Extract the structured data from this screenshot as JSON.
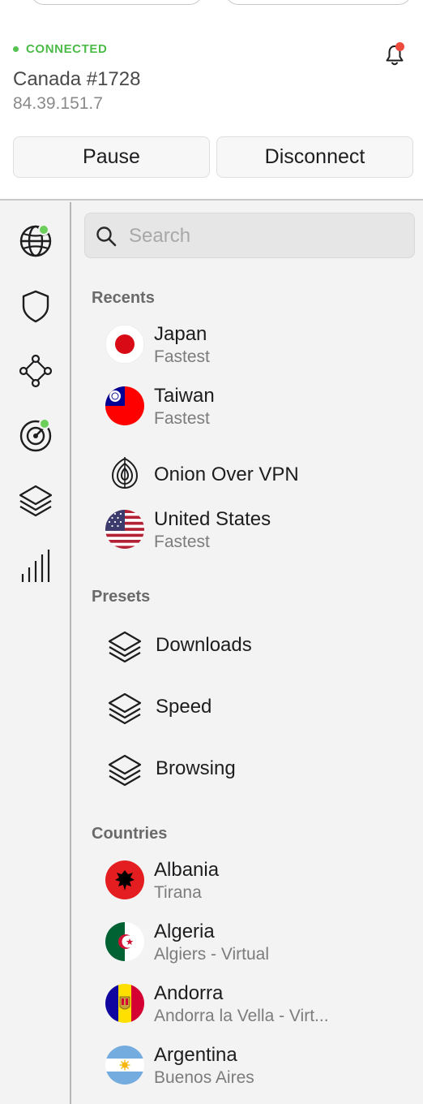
{
  "status": {
    "label": "CONNECTED",
    "color": "#4cbc48"
  },
  "server": {
    "name": "Canada #1728",
    "ip": "84.39.151.7"
  },
  "actions": {
    "pause": "Pause",
    "disconnect": "Disconnect"
  },
  "notifications": {
    "icon": "bell-icon",
    "has_badge": true
  },
  "rail": [
    {
      "icon": "globe-icon",
      "badge": true
    },
    {
      "icon": "shield-icon",
      "badge": false
    },
    {
      "icon": "meshnet-icon",
      "badge": false
    },
    {
      "icon": "threat-target-icon",
      "badge": true
    },
    {
      "icon": "layers-icon",
      "badge": false
    },
    {
      "icon": "stats-bars-icon",
      "badge": false
    }
  ],
  "search": {
    "placeholder": "Search"
  },
  "recents": {
    "title": "Recents",
    "items": [
      {
        "name": "Japan",
        "sub": "Fastest",
        "flag": "japan-flag-icon"
      },
      {
        "name": "Taiwan",
        "sub": "Fastest",
        "flag": "taiwan-flag-icon"
      },
      {
        "name": "Onion Over VPN",
        "sub": "",
        "flag": "onion-icon"
      },
      {
        "name": "United States",
        "sub": "Fastest",
        "flag": "us-flag-icon"
      }
    ]
  },
  "presets": {
    "title": "Presets",
    "items": [
      {
        "name": "Downloads",
        "icon": "layers-icon"
      },
      {
        "name": "Speed",
        "icon": "layers-icon"
      },
      {
        "name": "Browsing",
        "icon": "layers-icon"
      }
    ]
  },
  "countries": {
    "title": "Countries",
    "items": [
      {
        "name": "Albania",
        "sub": "Tirana",
        "flag": "albania-flag-icon"
      },
      {
        "name": "Algeria",
        "sub": "Algiers - Virtual",
        "flag": "algeria-flag-icon"
      },
      {
        "name": "Andorra",
        "sub": "Andorra la Vella - Virt...",
        "flag": "andorra-flag-icon"
      },
      {
        "name": "Argentina",
        "sub": "Buenos Aires",
        "flag": "argentina-flag-icon"
      }
    ]
  }
}
